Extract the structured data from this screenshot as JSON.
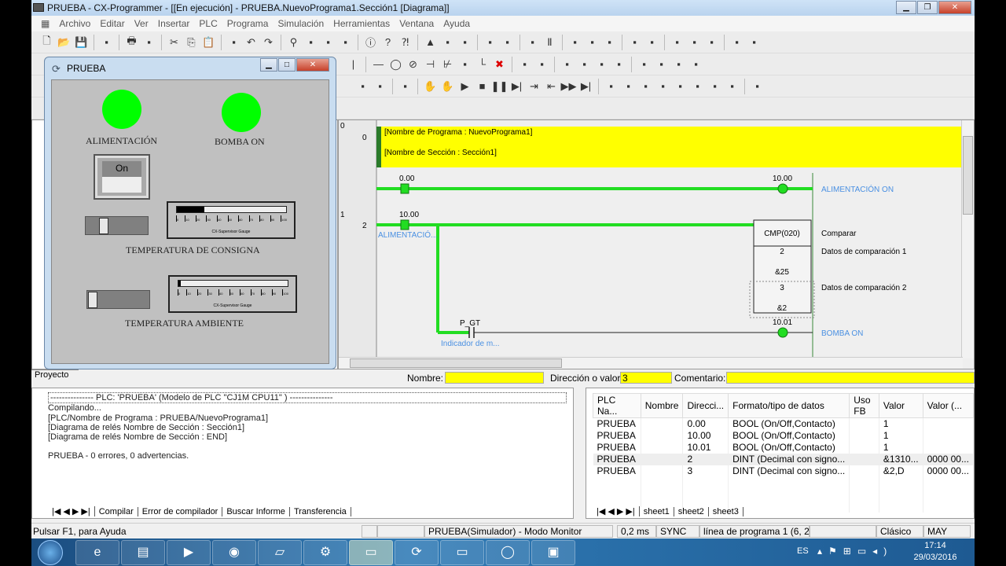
{
  "window": {
    "title": "PRUEBA - CX-Programmer - [[En ejecución] - PRUEBA.NuevoPrograma1.Sección1 [Diagrama]]"
  },
  "menu": [
    "Archivo",
    "Editar",
    "Ver",
    "Insertar",
    "PLC",
    "Programa",
    "Simulación",
    "Herramientas",
    "Ventana",
    "Ayuda"
  ],
  "toolbar1": [
    "new-icon",
    "open-icon",
    "save-icon",
    "|",
    "find-file-icon",
    "|",
    "print-icon",
    "print-preview-icon",
    "|",
    "cut-icon",
    "copy-icon",
    "paste-icon",
    "|",
    "paste-special-icon",
    "undo-icon",
    "redo-icon",
    "|",
    "binoculars-icon",
    "replace-icon",
    "rename-icon",
    "address-icon",
    "|",
    "info-icon",
    "help-icon",
    "context-help-icon",
    "|",
    "warning-icon",
    "online-icon",
    "search-warn-icon",
    "|",
    "lock-icon",
    "transfer-icon",
    "|",
    "compile-icon",
    "pause-icon",
    "|",
    "monitor-icon",
    "debug-icon",
    "cross-ref-icon",
    "|",
    "plc-info-icon",
    "plc-setup-icon",
    "|",
    "io-table-icon",
    "memory-icon",
    "error-log-icon",
    "|",
    "diff-icon",
    "data-trace-icon"
  ],
  "toolbar2": [
    "wire-icon",
    "|",
    "line-icon",
    "coil-icon",
    "not-coil-icon",
    "contact-icon",
    "nc-contact-icon",
    "instr-icon",
    "corner-icon",
    "delete-icon",
    "|",
    "view-icon",
    "zoom-icon",
    "|",
    "sym-icon",
    "sym2-icon",
    "sym3-icon",
    "sym4-icon",
    "|",
    "table-icon",
    "table2-icon",
    "table3-icon",
    "table4-icon"
  ],
  "toolbar3": [
    "sim-a-icon",
    "sim-b-icon",
    "|",
    "sim-c-icon",
    "|",
    "hand-icon",
    "hand2-icon",
    "play-icon",
    "stop-icon",
    "pause-sim-icon",
    "step-icon",
    "step-in-icon",
    "step-out-icon",
    "run-icon",
    "end-icon",
    "|",
    "g1-icon",
    "g2-icon",
    "g3-icon",
    "g4-icon",
    "g5-icon",
    "g6-icon",
    "g7-icon",
    "g8-icon",
    "|",
    "g9-icon"
  ],
  "diagram": {
    "rung_numbers": [
      "0",
      "1"
    ],
    "step_numbers": [
      "0",
      "2"
    ],
    "program_comment": "[Nombre de Programa : NuevoPrograma1]",
    "section_comment": "[Nombre de Sección : Sección1]",
    "rung0": {
      "contact": "0.00",
      "coil": "10.00",
      "coil_comment": "ALIMENTACIÓN ON"
    },
    "rung1": {
      "contact": "10.00",
      "contact_comment": "ALIMENTACIÓ...",
      "instr": "CMP(020)",
      "instr_comment": "Comparar",
      "op1": "2",
      "op1_val": "&25",
      "op1_comment": "Datos de comparación 1",
      "op2": "3",
      "op2_val": "&2",
      "op2_comment": "Datos de comparación 2",
      "flag": "P_GT",
      "flag_comment": "Indicador de m...",
      "coil": "10.01",
      "coil_comment": "BOMBA ON"
    }
  },
  "inputs": {
    "name_label": "Nombre:",
    "name_value": "",
    "addr_label": "Dirección o valor:",
    "addr_value": "3",
    "comment_label": "Comentario:",
    "comment_value": ""
  },
  "project_tab": "Proyecto",
  "prueba_window": {
    "title": "PRUEBA",
    "lamp1": "ALIMENTACIÓN",
    "lamp2": "BOMBA ON",
    "switch": "On",
    "gauge1_label": "TEMPERATURA DE CONSIGNA",
    "gauge2_label": "TEMPERATURA AMBIENTE",
    "gauge_caption": "CX-Supervisor Gauge",
    "gauge_ticks": [
      "0",
      "10",
      "20",
      "30",
      "40",
      "50",
      "60",
      "70",
      "80",
      "90",
      "100"
    ],
    "gauge1_value": 25,
    "gauge2_value": 2,
    "slider1_value": 25,
    "slider2_value": 2
  },
  "output": {
    "lines": [
      "--------------- PLC: 'PRUEBA' (Modelo de PLC \"CJ1M CPU11\" ) ---------------",
      "Compilando...",
      "[PLC/Nombre de Programa : PRUEBA/NuevoPrograma1]",
      "[Diagrama de relés Nombre de Sección : Sección1]",
      "[Diagrama de relés Nombre de Sección : END]",
      "",
      "PRUEBA - 0 errores, 0 advertencias."
    ],
    "tabs": [
      "Compilar",
      "Error de compilador",
      "Buscar Informe",
      "Transferencia"
    ]
  },
  "watch": {
    "columns": [
      "PLC Na...",
      "Nombre",
      "Direcci...",
      "Formato/tipo de datos",
      "Uso FB",
      "Valor",
      "Valor (..."
    ],
    "rows": [
      [
        "PRUEBA",
        "",
        "0.00",
        "BOOL (On/Off,Contacto)",
        "",
        "1",
        ""
      ],
      [
        "PRUEBA",
        "",
        "10.00",
        "BOOL (On/Off,Contacto)",
        "",
        "1",
        ""
      ],
      [
        "PRUEBA",
        "",
        "10.01",
        "BOOL (On/Off,Contacto)",
        "",
        "1",
        ""
      ],
      [
        "PRUEBA",
        "",
        "2",
        "DINT (Decimal con signo...",
        "",
        "&1310...",
        "0000 00..."
      ],
      [
        "PRUEBA",
        "",
        "3",
        "DINT (Decimal con signo...",
        "",
        "&2,D",
        "0000 00..."
      ]
    ],
    "tabs": [
      "sheet1",
      "sheet2",
      "sheet3"
    ]
  },
  "status": {
    "help": "Pulsar F1, para Ayuda",
    "mode": "PRUEBA(Simulador) - Modo Monitor",
    "cycle": "0,2 ms",
    "sync": "SYNC",
    "position": "línea de programa 1 (6, 2",
    "style": "Clásico",
    "caps": "MAY"
  },
  "taskbar": {
    "lang": "ES",
    "time": "17:14",
    "date": "29/03/2016"
  }
}
